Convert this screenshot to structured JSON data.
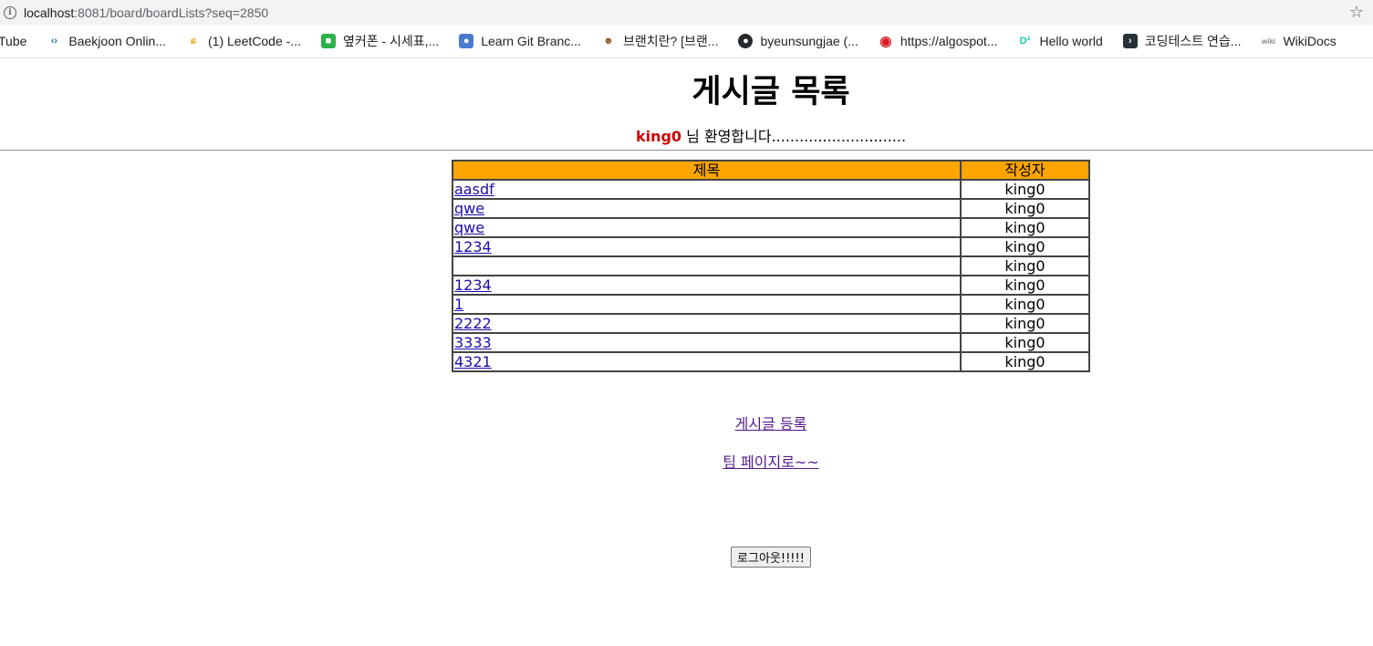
{
  "browser": {
    "url_host": "localhost",
    "url_path": ":8081/board/boardLists?seq=2850"
  },
  "bookmarks": [
    {
      "label": "Tube",
      "icon": "youtube-icon"
    },
    {
      "label": "Baekjoon Onlin...",
      "icon": "baekjoon-icon"
    },
    {
      "label": "(1) LeetCode -...",
      "icon": "leetcode-icon"
    },
    {
      "label": "옆커폰 - 시세표,...",
      "icon": "phone-shop-icon"
    },
    {
      "label": "Learn Git Branc...",
      "icon": "git-icon"
    },
    {
      "label": "브랜치란? [브랜...",
      "icon": "branch-icon"
    },
    {
      "label": "byeunsungjae (...",
      "icon": "github-icon"
    },
    {
      "label": "https://algospot...",
      "icon": "algospot-icon"
    },
    {
      "label": "Hello world",
      "icon": "d2-icon"
    },
    {
      "label": "코딩테스트 연습...",
      "icon": "programmers-icon"
    },
    {
      "label": "WikiDocs",
      "icon": "wikidocs-icon"
    }
  ],
  "page": {
    "heading": "게시글 목록",
    "welcome_user": "king0",
    "welcome_text": " 님 환영합니다.............................",
    "table": {
      "headers": [
        "제목",
        "작성자"
      ],
      "rows": [
        {
          "title": "aasdf",
          "author": "king0"
        },
        {
          "title": "qwe",
          "author": "king0"
        },
        {
          "title": "qwe",
          "author": "king0"
        },
        {
          "title": "1234",
          "author": "king0"
        },
        {
          "title": "",
          "author": "king0"
        },
        {
          "title": "1234",
          "author": "king0"
        },
        {
          "title": "1",
          "author": "king0"
        },
        {
          "title": "2222",
          "author": "king0"
        },
        {
          "title": "3333",
          "author": "king0"
        },
        {
          "title": "4321",
          "author": "king0"
        }
      ]
    },
    "register_link": "게시글 등록",
    "team_link": "팀 페이지로~~",
    "logout_button": "로그아웃!!!!!"
  }
}
